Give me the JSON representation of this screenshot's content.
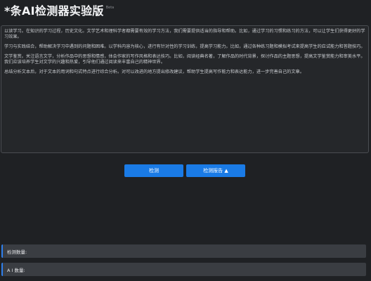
{
  "header": {
    "title": "*条AI检测器实验版",
    "badge": "Beta"
  },
  "editor": {
    "paragraphs": [
      "以读学习。在知识的学习过程，历史文化。文学艺术和理科学者都需要有效的学习方法，我们需要提供适当的指导和帮助。比如，通过学习的习惯和练习的方法，可以让学生们获得更好的学习效果。",
      "学习与实践结合，帮助解决学习中遇到的问题和困难。以学科内容为核心，进行有针对性的学习训练，提高学习能力。比如，通过各种练习题和模拟考试来提高学生的应试能力和答题技巧。",
      "文学鉴赏。关注语言文学，分析作品中的思想和情感，体会作家的写作风格和表达技巧。比如，阅读经典名著，了解作品的时代背景，探讨作品的主题思想，提高文学鉴赏能力和审美水平。我们应该培养学生对文学的兴趣和热爱，引导他们通过阅读来丰富自己的精神世界。",
      "总结分析文本后，对于文本的用词和句式特点进行综合分析。对可以改进的地方提出修改建议，帮助学生提高写作能力和表达能力，进一步完善自己的文章。"
    ]
  },
  "buttons": {
    "detect_label": "检测",
    "report_label": "检测报告 ▲"
  },
  "panels": {
    "detect_count_label": "检测数量:",
    "ai_count_label": "A I 数量:"
  }
}
